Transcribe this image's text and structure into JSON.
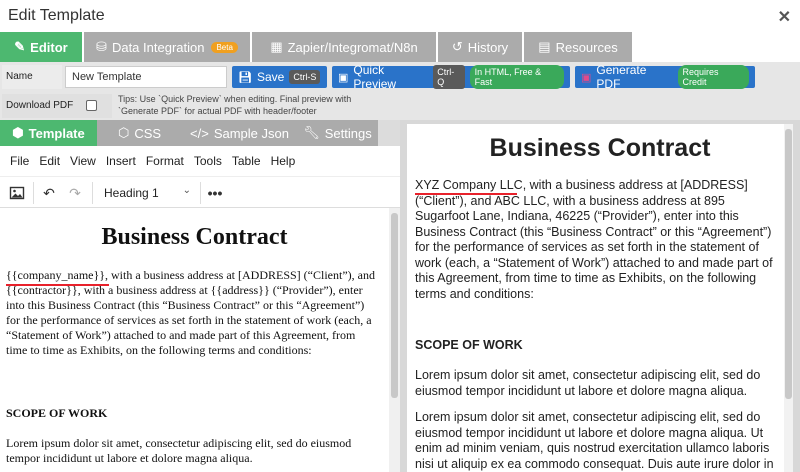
{
  "window": {
    "title": "Edit Template"
  },
  "main_tabs": [
    {
      "label": "Editor",
      "icon": "pencil-icon"
    },
    {
      "label": "Data Integration",
      "icon": "database-icon",
      "badge": "Beta"
    },
    {
      "label": "Zapier/Integromat/N8n",
      "icon": "table-icon"
    },
    {
      "label": "History",
      "icon": "history-icon"
    },
    {
      "label": "Resources",
      "icon": "book-icon"
    }
  ],
  "toolbar": {
    "name_label": "Name",
    "name_value": "New Template",
    "save_label": "Save",
    "save_shortcut": "Ctrl-S",
    "preview_label": "Quick Preview",
    "preview_shortcut": "Ctrl-Q",
    "preview_badge": "In HTML, Free & Fast",
    "pdf_label": "Generate PDF",
    "pdf_badge": "Requires Credit",
    "download_label": "Download PDF",
    "tips": "Tips: Use `Quick Preview` when editing. Final preview with `Generate PDF` for actual PDF with header/footer"
  },
  "sub_tabs": [
    {
      "label": "Template",
      "icon": "html5-icon"
    },
    {
      "label": "CSS",
      "icon": "css3-icon"
    },
    {
      "label": "Sample Json",
      "icon": "code-icon"
    },
    {
      "label": "Settings",
      "icon": "wrench-icon"
    }
  ],
  "editor": {
    "menu": [
      "File",
      "Edit",
      "View",
      "Insert",
      "Format",
      "Tools",
      "Table",
      "Help"
    ],
    "block_format": "Heading 1",
    "doc": {
      "title": "Business Contract",
      "var_company": "{{company_name}}",
      "para_a": ", with a business address at [ADDRESS] (“Client”), and ",
      "var_contractor": "{{contractor}}",
      "para_b": ", with a business address at ",
      "var_address": "{{address}}",
      "para_c": " (“Provider”), enter into this Business Contract (this “Business Contract” or this “Agreement”) for the performance of services as set forth in the statement of work (each, a “Statement of Work”) attached to and made part of this Agreement, from time to time as Exhibits, on the following terms and conditions:",
      "scope": "SCOPE OF WORK",
      "lorem": "Lorem ipsum dolor sit amet, consectetur adipiscing elit, sed do eiusmod tempor incididunt ut labore et dolore magna aliqua."
    }
  },
  "preview": {
    "title": "Business Contract",
    "company": "XYZ Company LLC",
    "para": ", with a business address at [ADDRESS] (“Client”), and ABC LLC, with a business address at 895 Sugarfoot Lane, Indiana, 46225 (“Provider”), enter into this Business Contract (this “Business Contract” or this “Agreement”) for the performance of services as set forth in the statement of work (each, a “Statement of Work”) attached to and made part of this Agreement, from time to time as Exhibits, on the following terms and conditions:",
    "scope": "SCOPE OF WORK",
    "lorem1": "Lorem ipsum dolor sit amet, consectetur adipiscing elit, sed do eiusmod tempor incididunt ut labore et dolore magna aliqua.",
    "lorem2": "Lorem ipsum dolor sit amet, consectetur adipiscing elit, sed do eiusmod tempor incididunt ut labore et dolore magna aliqua. Ut enim ad minim veniam, quis nostrud exercitation ullamco laboris nisi ut aliquip ex ea commodo consequat. Duis aute irure dolor in"
  },
  "colors": {
    "accent_green": "#4db870",
    "tab_gray": "#ababab",
    "button_blue": "#2a73c9",
    "underline_red": "#e8212b"
  }
}
